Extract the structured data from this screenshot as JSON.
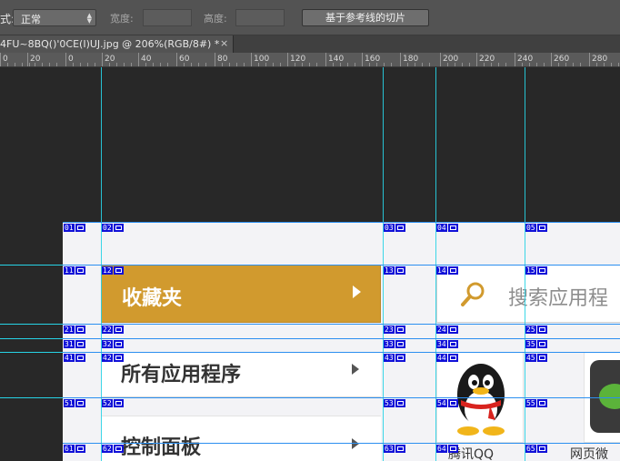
{
  "options_bar": {
    "style_colon": "式:",
    "style_value": "正常",
    "width_label": "宽度:",
    "height_label": "高度:",
    "slice_button": "基于参考线的切片"
  },
  "tab": {
    "title": "4FU~8BQ()'0CE(I)UJ.jpg @ 206%(RGB/8#) *",
    "close": "×"
  },
  "ruler": {
    "labels": [
      "0",
      "20",
      "0",
      "20",
      "40",
      "60",
      "80",
      "100",
      "120",
      "140",
      "160",
      "180",
      "200",
      "220",
      "240",
      "260",
      "280"
    ]
  },
  "slices": [
    "01",
    "02",
    "03",
    "04",
    "05",
    "11",
    "12",
    "13",
    "14",
    "15",
    "21",
    "22",
    "23",
    "24",
    "25",
    "31",
    "32",
    "33",
    "34",
    "35",
    "41",
    "42",
    "43",
    "44",
    "45",
    "51",
    "52",
    "53",
    "54",
    "55",
    "61",
    "62",
    "63",
    "64",
    "65"
  ],
  "content": {
    "favorites_label": "收藏夹",
    "all_apps_label": "所有应用程序",
    "control_panel_label": "控制面板",
    "search_placeholder": "搜索应用程",
    "qq_label": "腾讯QQ",
    "wechat_label": "网页微"
  },
  "colors": {
    "favorites_bg": "#d19a2e",
    "slice_badge": "#1010d8",
    "guide": "#27d3e6",
    "slice_line": "#2b8ff0"
  }
}
